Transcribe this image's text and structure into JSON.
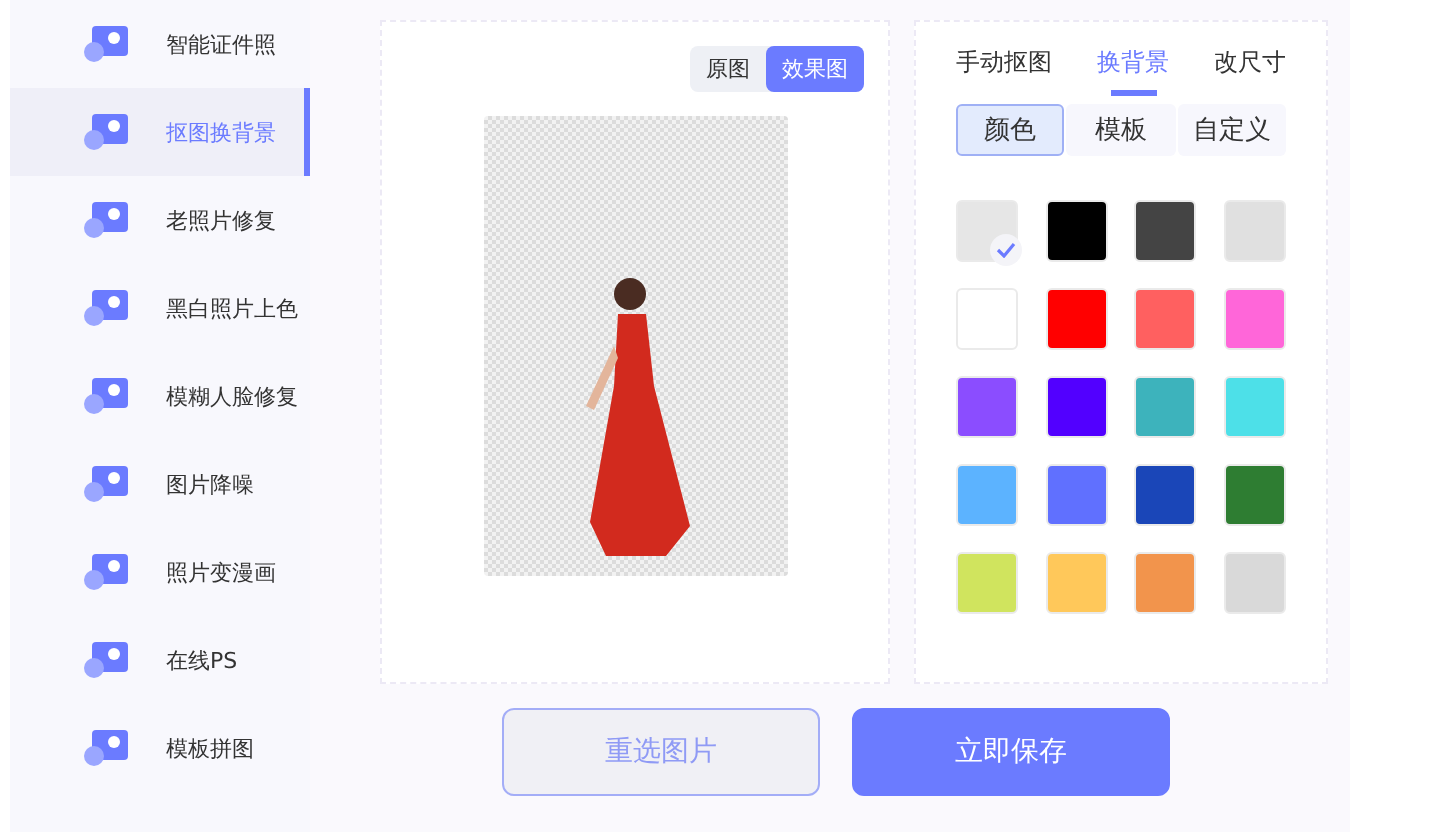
{
  "sidebar": {
    "items": [
      {
        "label": "智能证件照",
        "selected": false
      },
      {
        "label": "抠图换背景",
        "selected": true
      },
      {
        "label": "老照片修复",
        "selected": false
      },
      {
        "label": "黑白照片上色",
        "selected": false
      },
      {
        "label": "模糊人脸修复",
        "selected": false
      },
      {
        "label": "图片降噪",
        "selected": false
      },
      {
        "label": "照片变漫画",
        "selected": false
      },
      {
        "label": "在线PS",
        "selected": false
      },
      {
        "label": "模板拼图",
        "selected": false
      }
    ]
  },
  "preview": {
    "toggle": [
      {
        "label": "原图",
        "selected": false
      },
      {
        "label": "效果图",
        "selected": true
      }
    ]
  },
  "editor": {
    "tabs": [
      {
        "label": "手动抠图",
        "selected": false
      },
      {
        "label": "换背景",
        "selected": true
      },
      {
        "label": "改尺寸",
        "selected": false
      }
    ],
    "subtabs": [
      {
        "label": "颜色",
        "selected": true
      },
      {
        "label": "模板",
        "selected": false
      },
      {
        "label": "自定义",
        "selected": false
      }
    ],
    "swatches": [
      {
        "color": "#e6e6e6",
        "selected": true
      },
      {
        "color": "#000000",
        "selected": false
      },
      {
        "color": "#444444",
        "selected": false
      },
      {
        "color": "#e0e0e0",
        "selected": false
      },
      {
        "color": "#ffffff",
        "selected": false
      },
      {
        "color": "#ff0000",
        "selected": false
      },
      {
        "color": "#ff6060",
        "selected": false
      },
      {
        "color": "#ff66d9",
        "selected": false
      },
      {
        "color": "#8b4dff",
        "selected": false
      },
      {
        "color": "#5200ff",
        "selected": false
      },
      {
        "color": "#3db3bc",
        "selected": false
      },
      {
        "color": "#4de0e8",
        "selected": false
      },
      {
        "color": "#5cb3ff",
        "selected": false
      },
      {
        "color": "#6070ff",
        "selected": false
      },
      {
        "color": "#1a46b8",
        "selected": false
      },
      {
        "color": "#2e7d32",
        "selected": false
      },
      {
        "color": "#d0e45e",
        "selected": false
      },
      {
        "color": "#ffc85a",
        "selected": false
      },
      {
        "color": "#f2944c",
        "selected": false
      },
      {
        "color": "#d9d9d9",
        "selected": false
      }
    ]
  },
  "buttons": [
    {
      "label": "重选图片",
      "kind": "secondary"
    },
    {
      "label": "立即保存",
      "kind": "primary"
    }
  ]
}
